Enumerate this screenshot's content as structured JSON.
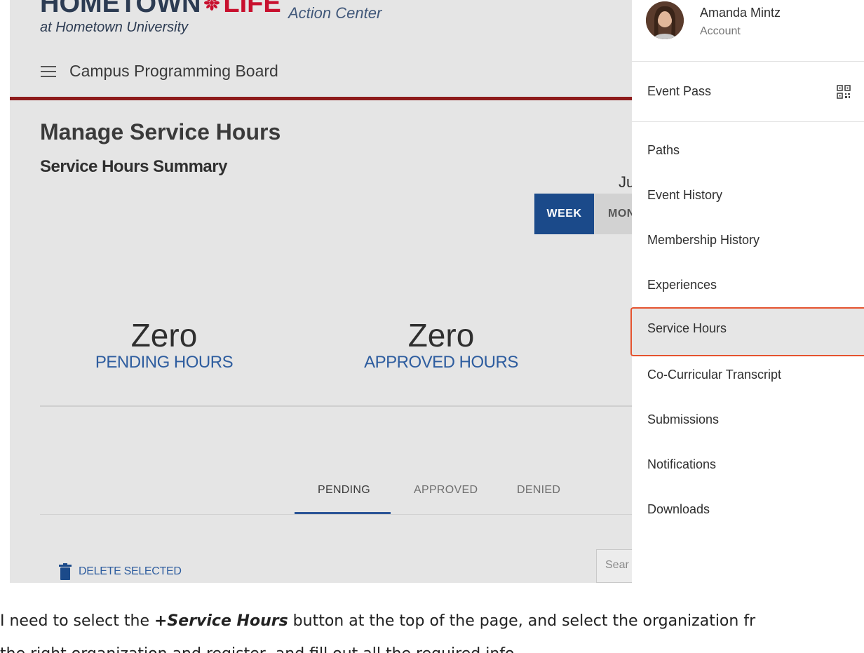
{
  "brand": {
    "logo_word_1": "HOMETOWN",
    "logo_word_2": "LIFE",
    "logo_sub": "at Hometown University",
    "product": "Action Center",
    "colors": {
      "navy": "#2c3b52",
      "red": "#c8102e"
    }
  },
  "nav": {
    "menu_icon": "hamburger-icon",
    "organization": "Campus Programming Board"
  },
  "page": {
    "title": "Manage Service Hours",
    "subtitle": "Service Hours Summary",
    "date_fragment": "Ju"
  },
  "range": {
    "week": "WEEK",
    "month": "MON",
    "selected": "WEEK",
    "accent": "#1b4a8a"
  },
  "stats": {
    "pending": {
      "value": "Zero",
      "label": "PENDING HOURS"
    },
    "approved": {
      "value": "Zero",
      "label": "APPROVED HOURS"
    }
  },
  "tabs": [
    {
      "label": "PENDING",
      "active": true
    },
    {
      "label": "APPROVED",
      "active": false
    },
    {
      "label": "DENIED",
      "active": false
    }
  ],
  "actions": {
    "delete_label": "DELETE SELECTED",
    "delete_icon": "trash-icon",
    "search_placeholder": "Sear"
  },
  "drawer": {
    "user_name": "Amanda Mintz",
    "user_sub": "Account",
    "event_pass": "Event Pass",
    "event_pass_icon": "qr-code-icon",
    "items": [
      {
        "label": "Paths"
      },
      {
        "label": "Event History"
      },
      {
        "label": "Membership History"
      },
      {
        "label": "Experiences"
      },
      {
        "label": "Service Hours",
        "highlighted": true
      },
      {
        "label": "Co-Curricular Transcript"
      },
      {
        "label": "Submissions"
      },
      {
        "label": "Notifications"
      },
      {
        "label": "Downloads"
      }
    ],
    "highlight_color": "#e5532f"
  },
  "caption": {
    "part1": "I need to select the ",
    "emphasis": "+Service Hours",
    "part2": " button at the top of the page, and select the organization fr",
    "line2": "the right organization and register, and fill out all the required info"
  }
}
